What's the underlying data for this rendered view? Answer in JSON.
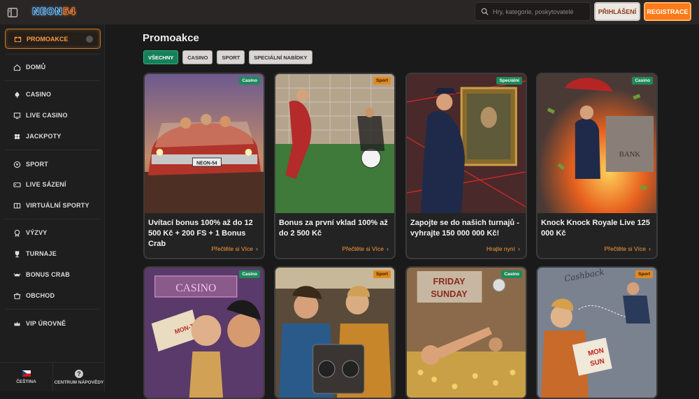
{
  "brand": {
    "name": "NEON",
    "number": "54"
  },
  "header": {
    "search_placeholder": "Hry, kategorie, poskytovatelé",
    "login_label": "PŘIHLÁŠENÍ",
    "register_label": "REGISTRACE"
  },
  "sidebar": {
    "active_item": {
      "label": "PROMOAKCE",
      "icon": "gift-icon"
    },
    "items": [
      {
        "label": "DOMŮ",
        "icon": "home-icon"
      },
      {
        "label": "CASINO",
        "icon": "cards-icon"
      },
      {
        "label": "LIVE CASINO",
        "icon": "live-casino-icon"
      },
      {
        "label": "JACKPOTY",
        "icon": "jackpot-icon"
      },
      {
        "label": "SPORT",
        "icon": "soccer-ball-icon"
      },
      {
        "label": "LIVE SÁZENÍ",
        "icon": "live-bet-icon"
      },
      {
        "label": "VIRTUÁLNÍ SPORTY",
        "icon": "virtual-sport-icon"
      },
      {
        "label": "VÝZVY",
        "icon": "challenge-icon"
      },
      {
        "label": "TURNAJE",
        "icon": "trophy-icon"
      },
      {
        "label": "BONUS CRAB",
        "icon": "crab-icon"
      },
      {
        "label": "OBCHOD",
        "icon": "shop-icon"
      },
      {
        "label": "VIP ÚROVNĚ",
        "icon": "vip-crown-icon"
      }
    ],
    "footer": {
      "language": "ČEŠTINA",
      "help": "CENTRUM NÁPOVĚDY",
      "help_glyph": "?"
    }
  },
  "page": {
    "title": "Promoakce",
    "filters": [
      "VŠECHNY",
      "CASINO",
      "SPORT",
      "SPECIÁLNÍ NABÍDKY"
    ],
    "active_filter": "VŠECHNY"
  },
  "promos": [
    {
      "badge": "Casino",
      "title": "Uvítací bonus 100% až do 12 500 Kč + 200 FS + 1 Bonus Crab",
      "link": "Přečtěte si Více",
      "scene": "car-heist"
    },
    {
      "badge": "Sport",
      "title": "Bonus za první vklad 100% až do 2 500 Kč",
      "link": "Přečtěte si Více",
      "scene": "soccer"
    },
    {
      "badge": "Speciální",
      "title": "Zapojte se do našich turnajů - vyhrajte 150 000 000 Kč!",
      "link": "Hrajte nyní",
      "scene": "museum"
    },
    {
      "badge": "Casino",
      "title": "Knock Knock Royale Live 125 000 Kč",
      "link": "Přečtěte si Více",
      "scene": "bank"
    },
    {
      "badge": "Casino",
      "title": "",
      "link": "",
      "scene": "casino-ticket"
    },
    {
      "badge": "Sport",
      "title": "",
      "link": "",
      "scene": "radio"
    },
    {
      "badge": "Casino",
      "title": "",
      "link": "",
      "scene": "friday-sunday"
    },
    {
      "badge": "Sport",
      "title": "",
      "link": "",
      "scene": "cashback"
    }
  ],
  "scene_text": {
    "car_plate": "NEON-54",
    "bank_sign": "BANK",
    "casino_sign": "CASINO",
    "ticket": "MON-THU",
    "friday": "FRIDAY",
    "sunday": "SUNDAY",
    "cashback": "Cashback",
    "mon_sun_1": "MON",
    "mon_sun_2": "SUN"
  },
  "colors": {
    "accent": "#ff7a18",
    "casino_badge": "#1d8a5a",
    "sport_badge": "#e28a1d",
    "active_filter": "#15805a"
  }
}
